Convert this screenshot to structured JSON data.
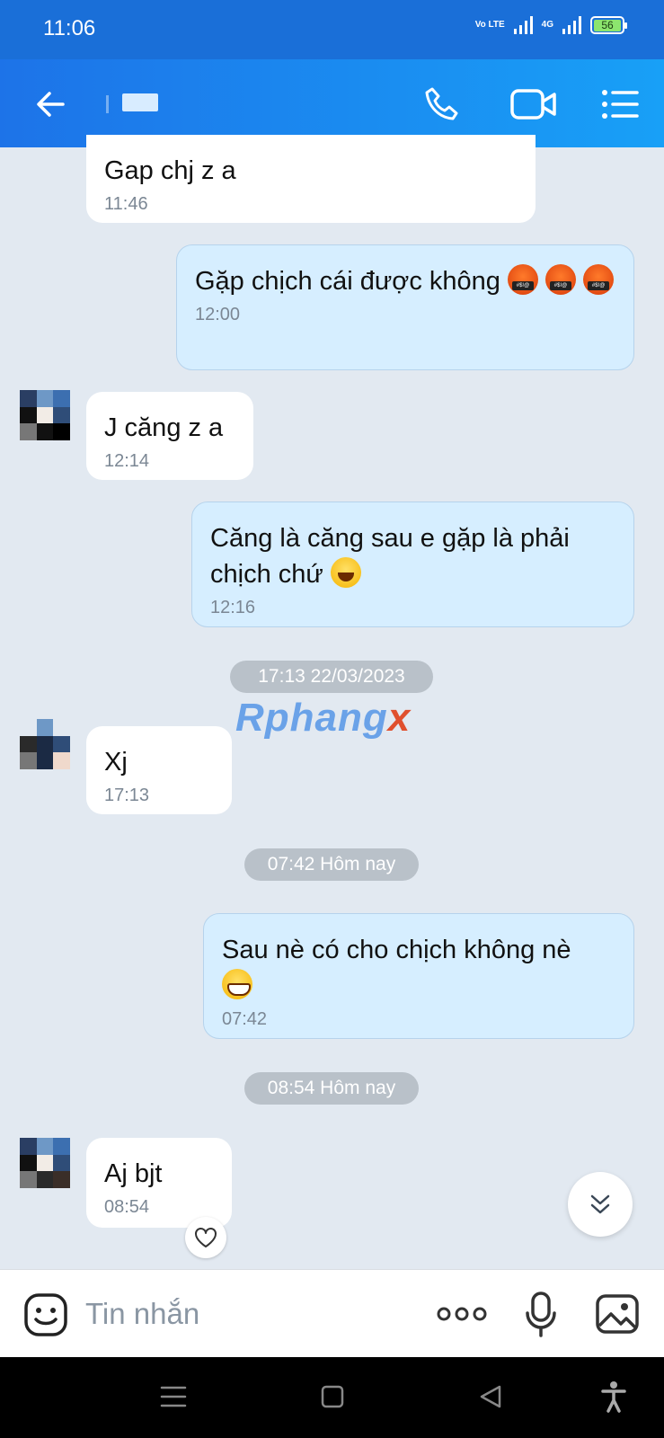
{
  "status_bar": {
    "time": "11:06",
    "network_label": "Vo LTE",
    "network2_label": "4G",
    "battery": "56"
  },
  "header": {
    "back_icon": "arrow-left-icon",
    "call_icon": "phone-icon",
    "video_icon": "video-camera-icon",
    "menu_icon": "list-menu-icon"
  },
  "messages": [
    {
      "direction": "in",
      "text": "Gap chj z a",
      "time": "11:46"
    },
    {
      "direction": "out",
      "text": "Gặp chịch cái được không",
      "time": "12:00",
      "emoji": "angry-cursing-face"
    },
    {
      "direction": "in",
      "text": "J căng z a",
      "time": "12:14"
    },
    {
      "direction": "out",
      "line1": "Căng là căng sau e gặp là phải",
      "line2": "chịch chứ",
      "time": "12:16",
      "emoji": "laughing-tears-face"
    },
    {
      "direction": "in",
      "text": "Xj",
      "time": "17:13"
    },
    {
      "direction": "out",
      "text": "Sau nè có cho chịch không nè",
      "time": "07:42",
      "emoji": "grinning-face"
    },
    {
      "direction": "in",
      "text": "Aj bjt",
      "time": "08:54"
    }
  ],
  "date_separators": [
    "17:13 22/03/2023",
    "07:42 Hôm nay",
    "08:54 Hôm nay"
  ],
  "watermark": {
    "main": "Rphang",
    "accent": "x"
  },
  "input": {
    "placeholder": "Tin nhắn",
    "sticker_icon": "emoji-sticker-icon",
    "more_icon": "more-dots-icon",
    "mic_icon": "microphone-icon",
    "image_icon": "image-gallery-icon"
  },
  "colors": {
    "header": "#1d73e8",
    "outgoing_bubble": "#d6eeff",
    "incoming_bubble": "#ffffff",
    "background": "#e2e9f1"
  }
}
